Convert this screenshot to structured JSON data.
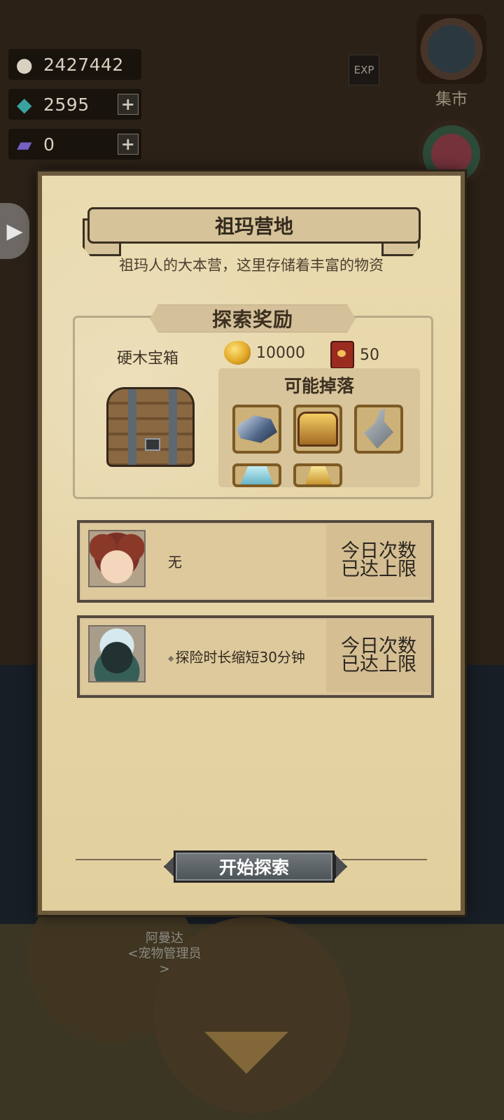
{
  "resources": [
    {
      "name": "gold",
      "icon": "gold-ore-icon",
      "value": "2427442",
      "has_plus": false
    },
    {
      "name": "gem",
      "icon": "teal-gem-icon",
      "value": "2595",
      "has_plus": true
    },
    {
      "name": "card",
      "icon": "purple-card-icon",
      "value": "0",
      "has_plus": true
    }
  ],
  "top_icons": {
    "exp": "EXP",
    "market_label": "集市"
  },
  "panel": {
    "title": "祖玛营地",
    "subtitle": "祖玛人的大本营，这里存储着丰富的物资",
    "reward_section_title": "探索奖励",
    "chest_name": "硬木宝箱",
    "gold_amount": "10000",
    "book_amount": "50",
    "drops_title": "可能掉落",
    "heroes": [
      {
        "avatar": "mouse-girl-avatar",
        "description": "无",
        "limit": "今日次数\n已达上限"
      },
      {
        "avatar": "armored-knight-avatar",
        "description": "探险时长缩短30分钟",
        "limit": "今日次数\n已达上限"
      }
    ],
    "start_button": "开始探索"
  },
  "background_npcs": {
    "left_name": "阿曼达",
    "left_role": "<宠物管理员>"
  }
}
